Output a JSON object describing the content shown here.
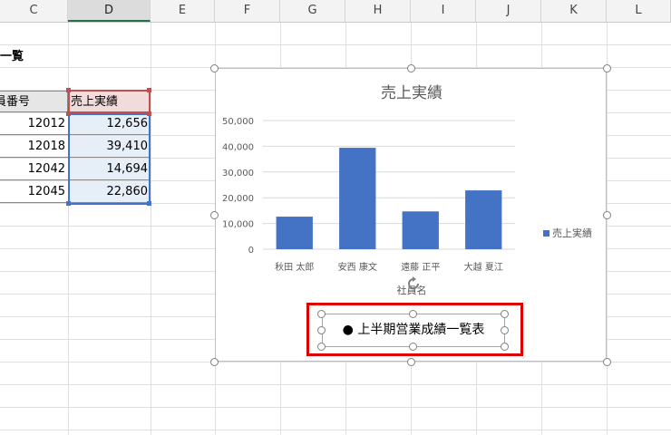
{
  "columns": [
    "C",
    "D",
    "E",
    "F",
    "G",
    "H",
    "I",
    "J",
    "K",
    "L"
  ],
  "sheet": {
    "title_partial": "一覧",
    "header_c": "社員番号",
    "header_d": "売上実績",
    "rows": [
      {
        "emp_no": "12012",
        "sales": "12,656"
      },
      {
        "emp_no": "12018",
        "sales": "39,410"
      },
      {
        "emp_no": "12042",
        "sales": "14,694"
      },
      {
        "emp_no": "12045",
        "sales": "22,860"
      }
    ]
  },
  "chart_data": {
    "type": "bar",
    "title": "売上実績",
    "xlabel": "社員名",
    "ylabel": "",
    "categories": [
      "秋田 太郎",
      "安西 康文",
      "遠藤 正平",
      "大越 夏江"
    ],
    "series": [
      {
        "name": "売上実績",
        "values": [
          12656,
          39410,
          14694,
          22860
        ]
      }
    ],
    "ylim": [
      0,
      50000
    ],
    "yticks": [
      "0",
      "10,000",
      "20,000",
      "30,000",
      "40,000",
      "50,000"
    ],
    "grid": true,
    "legend": "right",
    "bar_color": "#4472c4"
  },
  "textbox": {
    "text": "● 上半期営業成績一覧表"
  }
}
